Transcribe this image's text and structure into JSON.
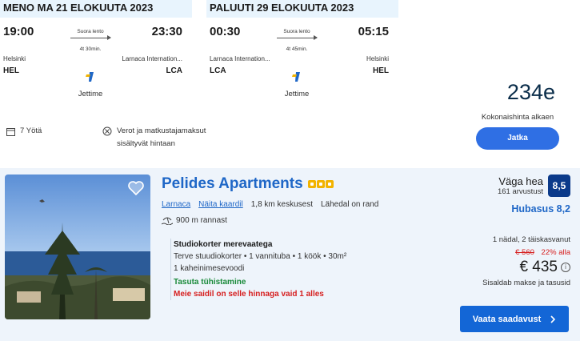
{
  "outbound": {
    "header": "MENO MA 21 ELOKUUTA 2023",
    "depart_time": "19:00",
    "arrive_time": "23:30",
    "flight_type": "Suora lento",
    "duration": "4t 30min.",
    "from_city": "Helsinki",
    "to_city": "Larnaca Internation...",
    "from_code": "HEL",
    "to_code": "LCA",
    "airline": "Jettime"
  },
  "return": {
    "header": "PALUUTI 29 ELOKUUTA 2023",
    "depart_time": "00:30",
    "arrive_time": "05:15",
    "flight_type": "Suora lento",
    "duration": "4t 45min.",
    "from_city": "Larnaca Internation...",
    "to_city": "Helsinki",
    "from_code": "LCA",
    "to_code": "HEL",
    "airline": "Jettime"
  },
  "extras": {
    "nights": "7 Yötä",
    "taxes": "Verot ja matkustajamaksut sisältyvät hintaan"
  },
  "price_summary": {
    "price": "234e",
    "label": "Kokonaishinta alkaen",
    "button": "Jatka"
  },
  "hotel": {
    "name": "Pelides Apartments",
    "stars": 3,
    "location": "Larnaca",
    "map_link": "Näita kaardil",
    "distance_center": "1,8 km keskusest",
    "near_beach": "Lähedal on rand",
    "beach_distance": "900 m rannast",
    "room_type": "Studiokorter merevaatega",
    "room_details": "Terve stuudiokorter • 1 vannituba • 1 köök • 30m²",
    "beds": "1 kaheinimesevoodi",
    "free_cancel": "Tasuta tühistamine",
    "last_one": "Meie saidil on selle hinnaga vaid 1 alles",
    "rating_word": "Väga hea",
    "reviews": "161 arvustust",
    "score": "8,5",
    "price_rating": "Hubasus 8,2",
    "stay": "1 nädal, 2 täiskasvanut",
    "old_price": "€ 560",
    "discount": "22% alla",
    "new_price": "€ 435",
    "includes": "Sisaldab makse ja tasusid",
    "cta": "Vaata saadavust"
  },
  "colors": {
    "accent": "#1f67c7",
    "button": "#2f6fe4",
    "score_badge": "#0b3a8a",
    "discount_red": "#d62020",
    "free_cancel_green": "#1a8a3a",
    "star": "#f2b300"
  },
  "icons": [
    "calendar-icon",
    "no-tax-icon",
    "airline-logo-icon",
    "heart-icon",
    "beach-icon",
    "info-icon",
    "chevron-right-icon"
  ]
}
